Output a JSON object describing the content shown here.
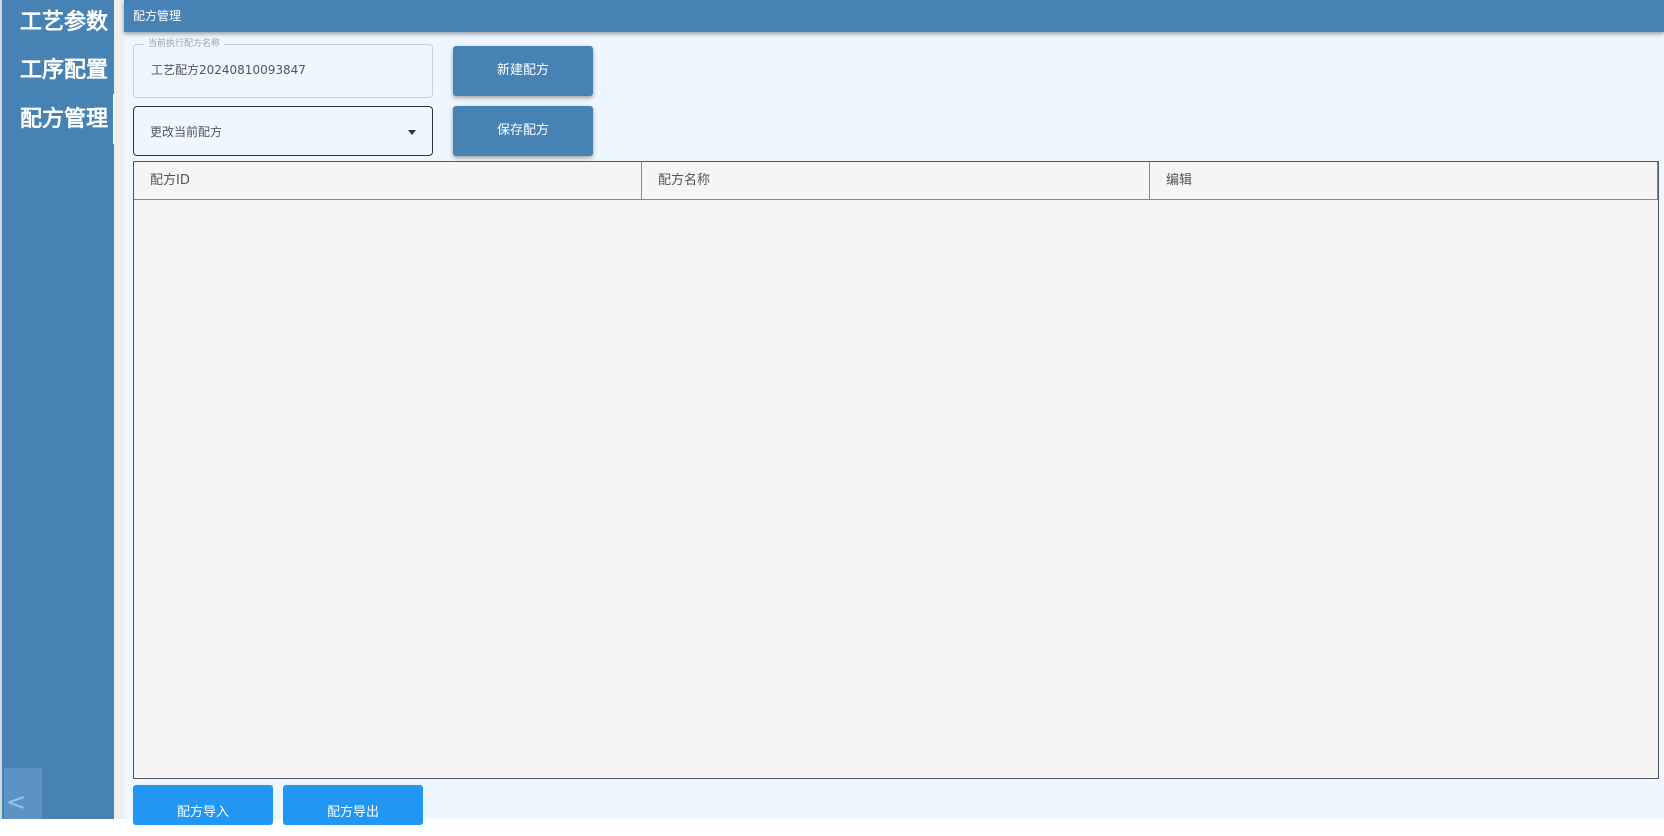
{
  "sidebar": {
    "items": [
      {
        "label": "工艺参数"
      },
      {
        "label": "工序配置"
      },
      {
        "label": "配方管理"
      }
    ],
    "collapse_label": "<"
  },
  "header": {
    "title": "配方管理"
  },
  "current_recipe": {
    "legend": "当前执行配方名称",
    "value": "工艺配方20240810093847"
  },
  "change_recipe": {
    "placeholder": "更改当前配方"
  },
  "buttons": {
    "new": "新建配方",
    "save": "保存配方",
    "import": "配方导入",
    "export": "配方导出"
  },
  "table": {
    "columns": [
      "配方ID",
      "配方名称",
      "编辑"
    ],
    "rows": []
  },
  "colors": {
    "primary": "#4682b4",
    "accent": "#2196f3",
    "background": "#eef6ff"
  }
}
